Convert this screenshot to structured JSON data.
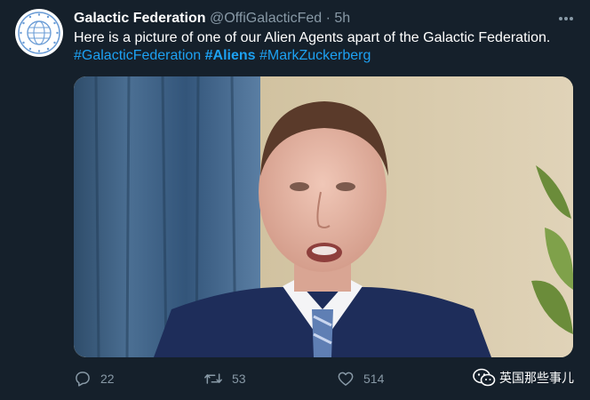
{
  "tweet": {
    "display_name": "Galactic Federation",
    "handle": "@OffiGalacticFed",
    "separator": "·",
    "time": "5h",
    "text_before": "Here is a picture of one of our Alien Agents apart of the Galactic Federation.",
    "hashtags": [
      "#GalacticFederation",
      "#Aliens",
      "#MarkZuckerberg"
    ]
  },
  "actions": {
    "replies": "22",
    "retweets": "53",
    "likes": "514"
  },
  "watermark": {
    "text": "英国那些事儿"
  },
  "icons": {
    "avatar": "galactic-federation-logo",
    "more": "more-dots-icon",
    "reply": "reply-icon",
    "retweet": "retweet-icon",
    "like": "heart-icon",
    "watermark": "wechat-icon"
  },
  "colors": {
    "background": "#15202b",
    "secondary_text": "#8899a6",
    "link": "#1da1f2"
  }
}
